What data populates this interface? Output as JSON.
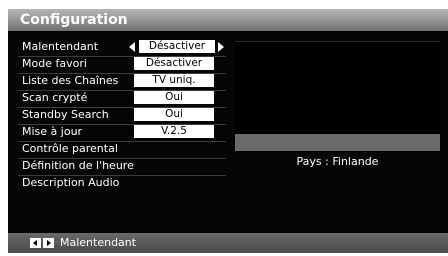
{
  "menu": {
    "title": "Configuration",
    "items": [
      {
        "label": "Malentendant",
        "value": "Désactiver",
        "selected": true
      },
      {
        "label": "Mode favori",
        "value": "Désactiver"
      },
      {
        "label": "Liste des Chaînes",
        "value": "TV uniq."
      },
      {
        "label": "Scan crypté",
        "value": "Oui"
      },
      {
        "label": "Standby Search",
        "value": "Oui"
      },
      {
        "label": "Mise à jour",
        "value": "V.2.5"
      },
      {
        "label": "Contrôle parental"
      },
      {
        "label": "Définition de l'heure"
      },
      {
        "label": "Description Audio"
      }
    ]
  },
  "info": {
    "country": "Pays : Finlande"
  },
  "footer": {
    "hint_icons": [
      "left-key-icon",
      "right-key-icon"
    ],
    "hint_label": "Malentendant"
  },
  "colors": {
    "background": "#050505",
    "title_bar": "#9a9a9a",
    "value_box": "#ffffff",
    "footer": "#5a5a5a"
  }
}
